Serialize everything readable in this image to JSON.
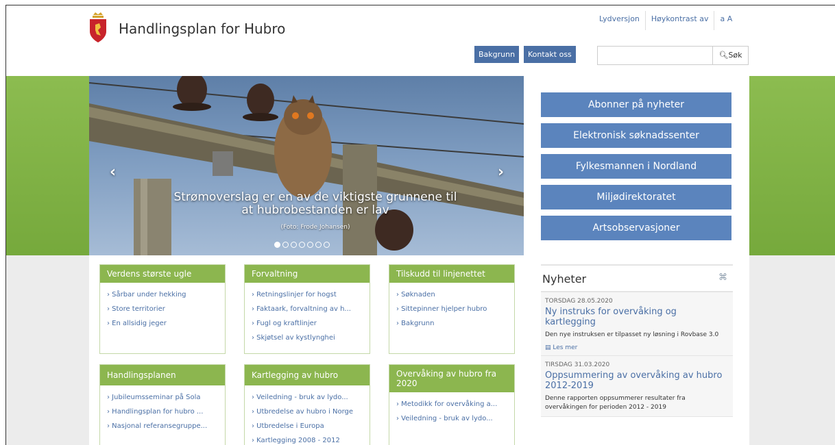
{
  "header": {
    "site_title": "Handlingsplan for Hubro",
    "top_links": [
      "Lydversjon",
      "Høykontrast av",
      "a A"
    ],
    "nav": [
      "Bakgrunn",
      "Kontakt oss"
    ],
    "search_placeholder": "",
    "search_button": "Søk"
  },
  "carousel": {
    "caption": "Strømoverslag er en av de viktigste grunnene til at hubrobestanden er lav",
    "credit": "(Foto: Frode Johansen)",
    "slide_count": 7,
    "active_slide": 1
  },
  "quick_links": [
    "Abonner på nyheter",
    "Elektronisk søknadssenter",
    "Fylkesmannen i Nordland",
    "Miljødirektoratet",
    "Artsobservasjoner"
  ],
  "boxes": [
    {
      "title": "Verdens største ugle",
      "items": [
        "› Sårbar under hekking",
        "› Store territorier",
        "› En allsidig jeger"
      ]
    },
    {
      "title": "Forvaltning",
      "items": [
        "› Retningslinjer for hogst",
        "› Faktaark, forvaltning av h...",
        "› Fugl og kraftlinjer",
        "› Skjøtsel av kystlynghei"
      ]
    },
    {
      "title": "Tilskudd til linjenettet",
      "items": [
        "› Søknaden",
        "› Sittepinner hjelper hubro",
        "› Bakgrunn"
      ]
    },
    {
      "title": "Handlingsplanen",
      "items": [
        "› Jubileumsseminar på Sola",
        "› Handlingsplan for hubro ...",
        "› Nasjonal referansegruppe..."
      ]
    },
    {
      "title": "Kartlegging av hubro",
      "items": [
        "› Veiledning - bruk av lydo...",
        "› Utbredelse av hubro i Norge",
        "› Utbredelse i Europa",
        "› Kartlegging 2008 - 2012"
      ]
    },
    {
      "title": "Overvåking av hubro fra 2020",
      "items": [
        "› Metodikk for overvåking a...",
        "› Veiledning - bruk av lydo..."
      ]
    }
  ],
  "news": {
    "title": "Nyheter",
    "items": [
      {
        "date": "TORSDAG 28.05.2020",
        "headline": "Ny instruks for overvåking og kartlegging",
        "text": "Den nye instruksen er tilpasset ny løsning i Rovbase 3.0",
        "more": "Les mer"
      },
      {
        "date": "TIRSDAG 31.03.2020",
        "headline": "Oppsummering av overvåking av hubro 2012-2019",
        "text": "Denne rapporten oppsummerer resultater fra overvåkingen for perioden 2012 - 2019",
        "more": ""
      }
    ]
  },
  "colors": {
    "accent_blue": "#4a6fa5",
    "button_blue": "#5b84bd",
    "green": "#8cb64f"
  },
  "icons": [
    "coat-of-arms-icon",
    "search-icon",
    "chevron-left-icon",
    "chevron-right-icon",
    "rss-icon",
    "document-icon"
  ]
}
